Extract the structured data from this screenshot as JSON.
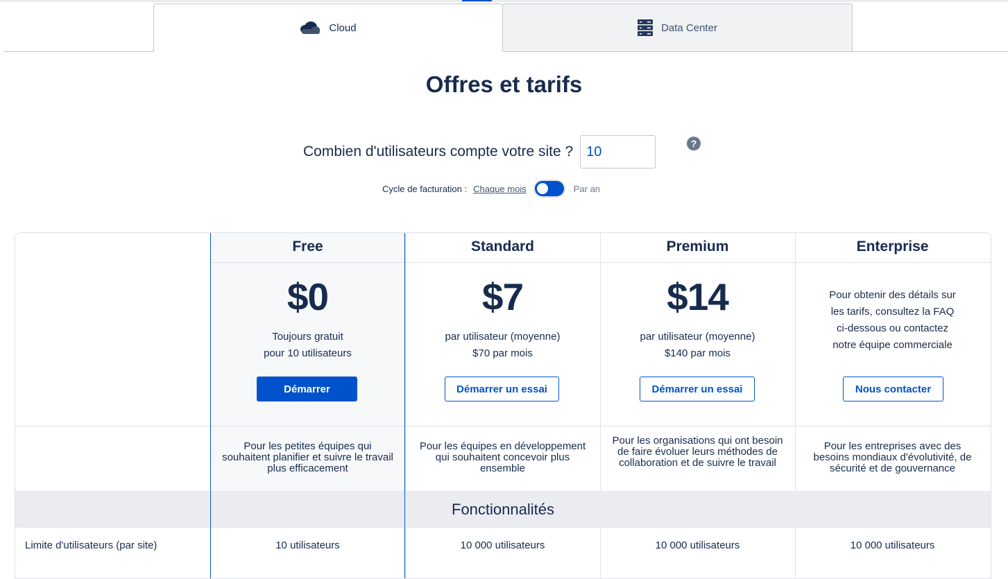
{
  "tabs": [
    {
      "label": "Cloud",
      "icon": "cloud-icon",
      "active": true
    },
    {
      "label": "Data Center",
      "icon": "server-icon",
      "active": false
    }
  ],
  "page_title": "Offres et tarifs",
  "users": {
    "question": "Combien d'utilisateurs compte votre site ?",
    "value": "10",
    "help_glyph": "?"
  },
  "billing": {
    "label": "Cycle de facturation :",
    "monthly": "Chaque mois",
    "yearly": "Par an",
    "selected": "Chaque mois"
  },
  "plans": [
    {
      "name": "Free",
      "price": "$0",
      "desc_line1": "Toujours gratuit",
      "desc_line2": "pour 10 utilisateurs",
      "cta": "Démarrer",
      "tagline": "Pour les petites équipes qui souhaitent planifier et suivre le travail plus efficacement",
      "user_limit": "10 utilisateurs"
    },
    {
      "name": "Standard",
      "price": "$7",
      "desc_line1": "par utilisateur (moyenne)",
      "desc_line2": "$70 par mois",
      "cta": "Démarrer un essai",
      "tagline": "Pour les équipes en développement qui souhaitent concevoir plus ensemble",
      "user_limit": "10 000 utilisateurs"
    },
    {
      "name": "Premium",
      "price": "$14",
      "desc_line1": "par utilisateur (moyenne)",
      "desc_line2": "$140 par mois",
      "cta": "Démarrer un essai",
      "tagline": "Pour les organisations qui ont besoin de faire évoluer leurs méthodes de collaboration et de suivre le travail",
      "user_limit": "10 000 utilisateurs"
    },
    {
      "name": "Enterprise",
      "desc_line1": "Pour obtenir des détails sur",
      "desc_line2": "les tarifs, consultez la FAQ",
      "desc_line3": "ci-dessous ou contactez",
      "desc_line4": "notre équipe commerciale",
      "cta": "Nous contacter",
      "tagline": "Pour les entreprises avec des besoins mondiaux d'évolutivité, de sécurité et de gouvernance",
      "user_limit": "10 000 utilisateurs"
    }
  ],
  "features": {
    "section_title": "Fonctionnalités",
    "row_label": "Limite d'utilisateurs (par site)"
  },
  "colors": {
    "brand": "#0052cc",
    "text": "#172b4d",
    "section_bg": "#ebecf0"
  }
}
